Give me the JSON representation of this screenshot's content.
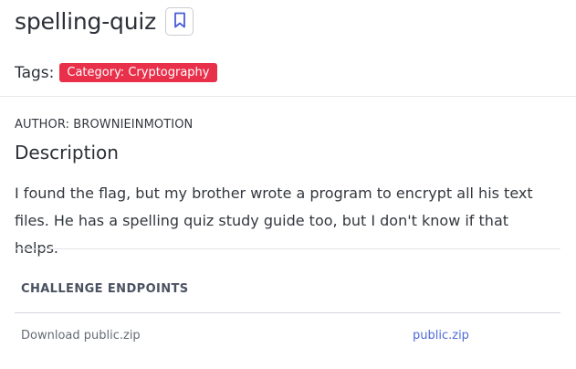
{
  "challenge": {
    "title": "spelling-quiz",
    "tags_label": "Tags:",
    "tags": [
      "Category: Cryptography"
    ],
    "author": "AUTHOR: BROWNIEINMOTION",
    "description_heading": "Description",
    "description": "I found the flag, but my brother wrote a program to encrypt all his text files. He has a spelling quiz study guide too, but I don't know if that helps."
  },
  "endpoints": {
    "heading": "CHALLENGE ENDPOINTS",
    "items": [
      {
        "label": "Download public.zip",
        "link_text": "public.zip"
      }
    ]
  },
  "colors": {
    "tag_background": "#e8304a",
    "link": "#4f6bd6",
    "bookmark_icon": "#4a5cd8"
  },
  "icons": {
    "bookmark": "bookmark-icon"
  }
}
